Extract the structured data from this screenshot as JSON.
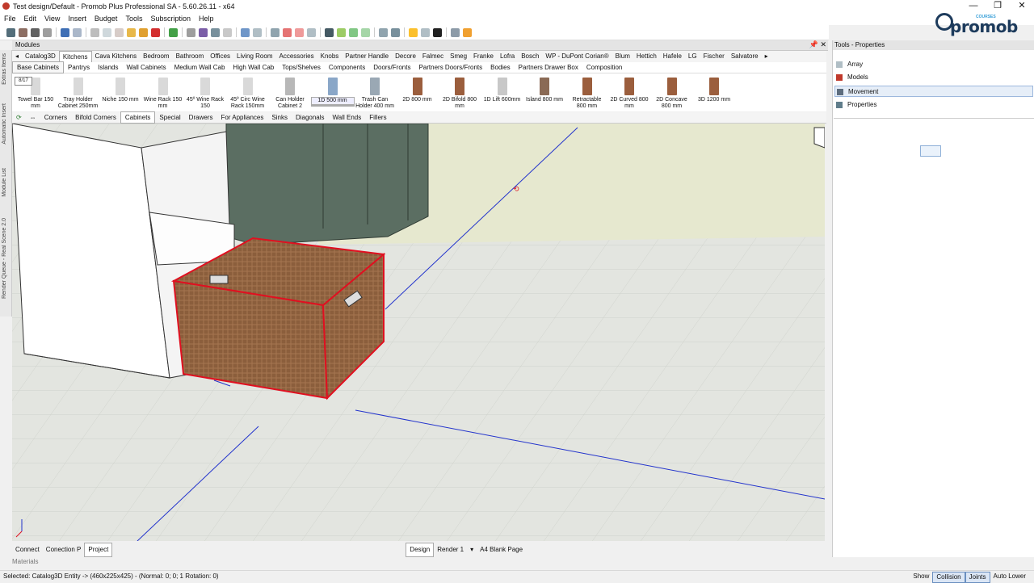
{
  "window": {
    "title": "Test design/Default - Promob Plus Professional SA - 5.60.26.11 - x64",
    "controls": [
      "—",
      "❐",
      "✕"
    ]
  },
  "menu": [
    "File",
    "Edit",
    "View",
    "Insert",
    "Budget",
    "Tools",
    "Subscription",
    "Help"
  ],
  "logo": {
    "text": "promob",
    "small": "COURSES"
  },
  "modules": {
    "title": "Modules",
    "pin": "📌",
    "close": "✕"
  },
  "catalog_tabs": [
    "Catalog3D",
    "Kitchens",
    "Cava Kitchens",
    "Bedroom",
    "Bathroom",
    "Offices",
    "Living Room",
    "Accessories",
    "Knobs",
    "Partner Handle",
    "Decore",
    "Falmec",
    "Smeg",
    "Franke",
    "Lofra",
    "Bosch",
    "WP - DuPont Corian®",
    "Blum",
    "Hettich",
    "Hafele",
    "LG",
    "Fischer",
    "Salvatore"
  ],
  "sub_tabs": [
    "Base Cabinets",
    "Pantrys",
    "Islands",
    "Wall Cabinets",
    "Medium Wall Cab",
    "High Wall Cab",
    "Tops/Shelves",
    "Components",
    "Doors/Fronts",
    "Partners Doors/Fronts",
    "Bodies",
    "Partners Drawer Box",
    "Composition"
  ],
  "page_badge": "8/17",
  "items": [
    {
      "l1": "Towel Bar 150",
      "l2": "mm",
      "color": "#d9d9d9"
    },
    {
      "l1": "Tray Holder",
      "l2": "Cabinet 250mm",
      "color": "#d9d9d9"
    },
    {
      "l1": "Niche 150 mm",
      "l2": "",
      "color": "#d9d9d9"
    },
    {
      "l1": "Wine Rack 150",
      "l2": "mm",
      "color": "#d9d9d9"
    },
    {
      "l1": "45º Wine Rack",
      "l2": "150",
      "color": "#d9d9d9"
    },
    {
      "l1": "45º Circ Wine",
      "l2": "Rack 150mm",
      "color": "#d9d9d9"
    },
    {
      "l1": "Can Holder",
      "l2": "Cabinet 2",
      "color": "#b8b8b8"
    },
    {
      "l1": "1D 500 mm",
      "l2": "",
      "color": "#8aa7c8"
    },
    {
      "l1": "Trash Can",
      "l2": "Holder 400 mm",
      "color": "#9aa8b4"
    },
    {
      "l1": "2D 800 mm",
      "l2": "",
      "color": "#9b5e3d"
    },
    {
      "l1": "2D Bifold 800",
      "l2": "mm",
      "color": "#9b5e3d"
    },
    {
      "l1": "1D Lift 600mm",
      "l2": "",
      "color": "#c8c8c8"
    },
    {
      "l1": "Island 800 mm",
      "l2": "",
      "color": "#8a6a55"
    },
    {
      "l1": "Retractable",
      "l2": "800 mm",
      "color": "#9b5e3d"
    },
    {
      "l1": "2D Curved 800",
      "l2": "mm",
      "color": "#9b5e3d"
    },
    {
      "l1": "2D Concave",
      "l2": "800 mm",
      "color": "#9b5e3d"
    },
    {
      "l1": "3D 1200 mm",
      "l2": "",
      "color": "#9b5e3d"
    }
  ],
  "tool_tabs": [
    "Corners",
    "Bifold Corners",
    "Cabinets",
    "Special",
    "Drawers",
    "For Appliances",
    "Sinks",
    "Diagonals",
    "Wall Ends",
    "Fillers"
  ],
  "left_strip": [
    "Extras Items",
    "Automatic Insert",
    "Module List",
    "Render Queue - Real Scene 2.0"
  ],
  "bottom_tabs": {
    "left": [
      "Connect",
      "Conection P",
      "Project"
    ],
    "center": [
      "Design",
      "Render 1",
      "A4 Blank Page"
    ]
  },
  "materials": "Materials",
  "status": {
    "left": "Selected: Catalog3D Entity ->  (460x225x425) - (Normal: 0; 0; 1 Rotation: 0)",
    "right": [
      "Show",
      "Collision",
      "Joints",
      "Auto Lower"
    ]
  },
  "right_panel": {
    "title": "Tools - Properties",
    "items": [
      "Array",
      "Models",
      "Movement",
      "Properties"
    ],
    "selected": "Movement"
  },
  "colors": {
    "selection": "#e01020",
    "guide": "#2233cc",
    "cabinet_green": "#5b6e62",
    "basket": "#8b5e3c"
  }
}
